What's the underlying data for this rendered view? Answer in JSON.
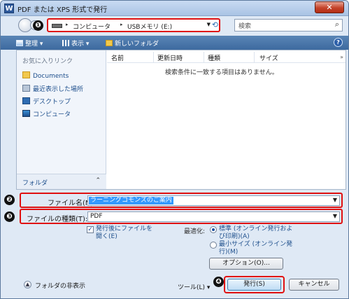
{
  "window": {
    "title": "PDF または XPS 形式で発行",
    "app_icon_letter": "W",
    "close_glyph": "✕"
  },
  "markers": [
    "❶",
    "❷",
    "❸",
    "❹"
  ],
  "address": {
    "crumbs": [
      "コンピュータ",
      "USBメモリ (E:)"
    ],
    "separator": "▸"
  },
  "search": {
    "placeholder": "検索",
    "icon": "search-icon"
  },
  "toolbar": {
    "organize_label": "整理",
    "view_label": "表示",
    "new_folder_label": "新しいフォルダ",
    "help_glyph": "?"
  },
  "sidebar": {
    "favorites_title": "お気に入りリンク",
    "items": [
      {
        "label": "Documents",
        "icon": "folder-icon"
      },
      {
        "label": "最近表示した場所",
        "icon": "recent-places-icon"
      },
      {
        "label": "デスクトップ",
        "icon": "desktop-icon"
      },
      {
        "label": "コンピュータ",
        "icon": "computer-icon"
      }
    ],
    "folder_label": "フォルダ",
    "folder_caret": "⌃"
  },
  "columns": [
    "名前",
    "更新日時",
    "種類",
    "サイズ"
  ],
  "empty_message": "検索条件に一致する項目はありません。",
  "form": {
    "filename_label": "ファイル名(N):",
    "filename_value": "ラーニングコモンズのご案内",
    "filetype_label": "ファイルの種類(T):",
    "filetype_value": "PDF"
  },
  "options": {
    "open_after_publish_line1": "発行後にファイルを",
    "open_after_publish_line2": "開く(E)",
    "optimize_label": "最適化:",
    "standard_line1": "標準 (オンライン発行およ",
    "standard_line2": "び印刷)(A)",
    "minimum_line1": "最小サイズ (オンライン発",
    "minimum_line2": "行)(M)",
    "options_button": "オプション(O)..."
  },
  "footer": {
    "hide_folders_label": "フォルダの非表示",
    "tools_label": "ツール(L)",
    "publish_button": "発行(S)",
    "cancel_button": "キャンセル"
  }
}
